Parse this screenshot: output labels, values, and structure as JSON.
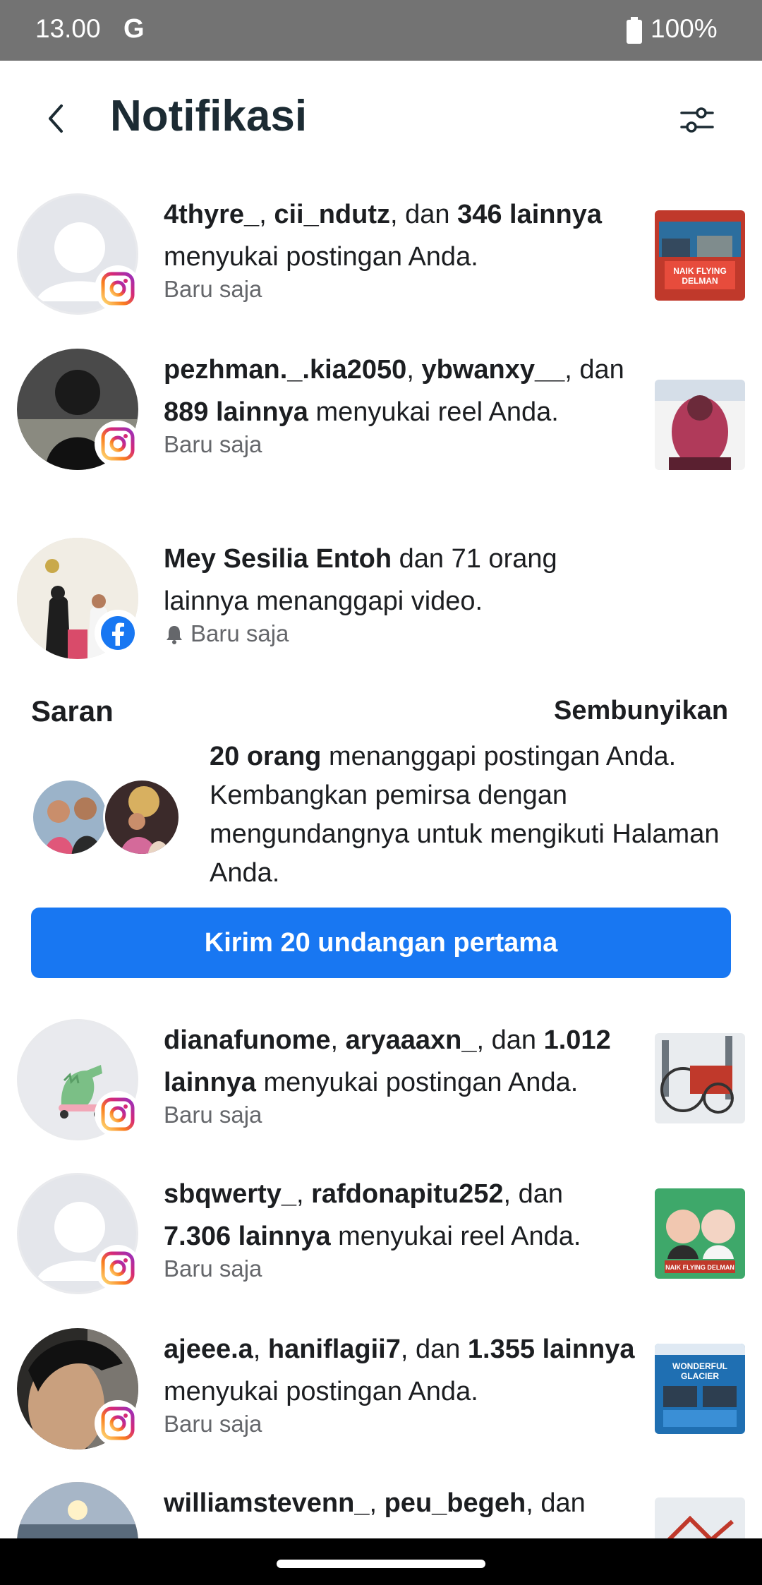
{
  "status": {
    "time": "13.00",
    "carrier": "G",
    "battery": "100%"
  },
  "header": {
    "title": "Notifikasi",
    "back_icon": "chevron-left-icon",
    "filter_icon": "sliders-icon"
  },
  "notifications": [
    {
      "user1": "4thyre_",
      "user2": "cii_ndutz",
      "sep": ", dan ",
      "others": "346 lainnya",
      "action": " menyukai postingan Anda.",
      "time": "Baru saja",
      "platform": "instagram"
    },
    {
      "user1": "pezhman._.kia2050",
      "user2": "ybwanxy__",
      "sep": ", dan ",
      "others": "889 lainnya",
      "action": " menyukai reel Anda.",
      "time": "Baru saja",
      "platform": "instagram"
    },
    {
      "user1": "Mey Sesilia Entoh",
      "action": " dan 71 orang lainnya menanggapi video.",
      "time": "Baru saja",
      "platform": "facebook"
    },
    {
      "user1": "dianafunome",
      "user2": "aryaaaxn_",
      "sep": ", dan ",
      "others": "1.012 lainnya",
      "action": " menyukai postingan Anda.",
      "time": "Baru saja",
      "platform": "instagram"
    },
    {
      "user1": "sbqwerty_",
      "user2": "rafdonapitu252",
      "sep": ", dan ",
      "others": "7.306 lainnya",
      "action": " menyukai reel Anda.",
      "time": "Baru saja",
      "platform": "instagram"
    },
    {
      "user1": "ajeee.a",
      "user2": "haniflagii7",
      "sep": ", dan ",
      "others": "1.355 lainnya",
      "action": " menyukai postingan Anda.",
      "time": "Baru saja",
      "platform": "instagram"
    },
    {
      "user1": "williamstevenn_",
      "user2": "peu_begeh",
      "sep": ", dan",
      "platform": "instagram"
    }
  ],
  "suggestion": {
    "title": "Saran",
    "hide": "Sembunyikan",
    "bold": "20 orang",
    "text": " menanggapi postingan Anda. Kembangkan pemirsa dengan mengundangnya untuk mengikuti Halaman Anda.",
    "button": "Kirim 20 undangan pertama"
  },
  "thumbs": [
    {
      "lines": [
        "NAIK FLYING",
        "DELMAN"
      ]
    },
    {
      "lines": []
    },
    {
      "lines": []
    },
    {
      "lines": [
        "NAIK FLYING DELMAN"
      ]
    },
    {
      "lines": [
        "WONDERFUL",
        "GLACIER"
      ]
    }
  ],
  "colors": {
    "accent": "#1877f2",
    "text": "#1c1e21",
    "muted": "#65676b",
    "status_bar": "#737373"
  }
}
